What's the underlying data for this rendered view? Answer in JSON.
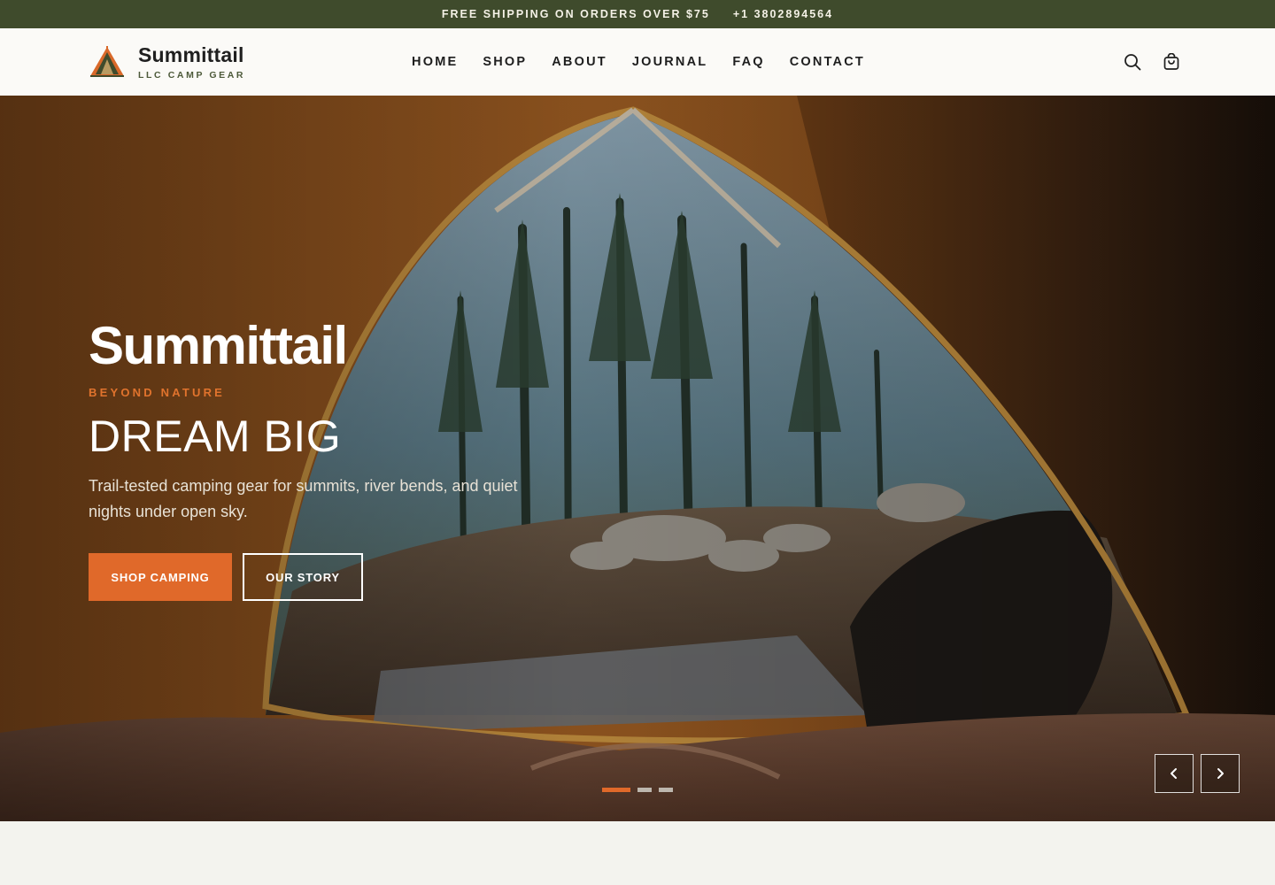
{
  "announcement": {
    "shipping": "FREE SHIPPING ON ORDERS OVER $75",
    "phone": "+1 3802894564"
  },
  "brand": {
    "name": "Summittail",
    "tagline": "LLC CAMP GEAR",
    "logo_icon": "tent-logo-icon"
  },
  "nav": {
    "items": [
      {
        "label": "HOME"
      },
      {
        "label": "SHOP"
      },
      {
        "label": "ABOUT"
      },
      {
        "label": "JOURNAL"
      },
      {
        "label": "FAQ"
      },
      {
        "label": "CONTACT"
      }
    ]
  },
  "header_icons": {
    "search": "search-icon",
    "cart": "shopping-bag-icon"
  },
  "hero": {
    "brand": "Summittail",
    "eyebrow": "BEYOND NATURE",
    "title": "DREAM BIG",
    "description": "Trail-tested camping gear for summits, river bends, and quiet nights under open sky.",
    "primary_cta": "SHOP CAMPING",
    "secondary_cta": "OUR STORY",
    "slides_total": 3,
    "active_slide": 1,
    "prev_icon": "chevron-left-icon",
    "next_icon": "chevron-right-icon"
  },
  "colors": {
    "announcement_bg": "#3f4b2c",
    "accent": "#e0692a",
    "header_bg": "#fbfaf7",
    "page_bg": "#f3f3ee"
  }
}
